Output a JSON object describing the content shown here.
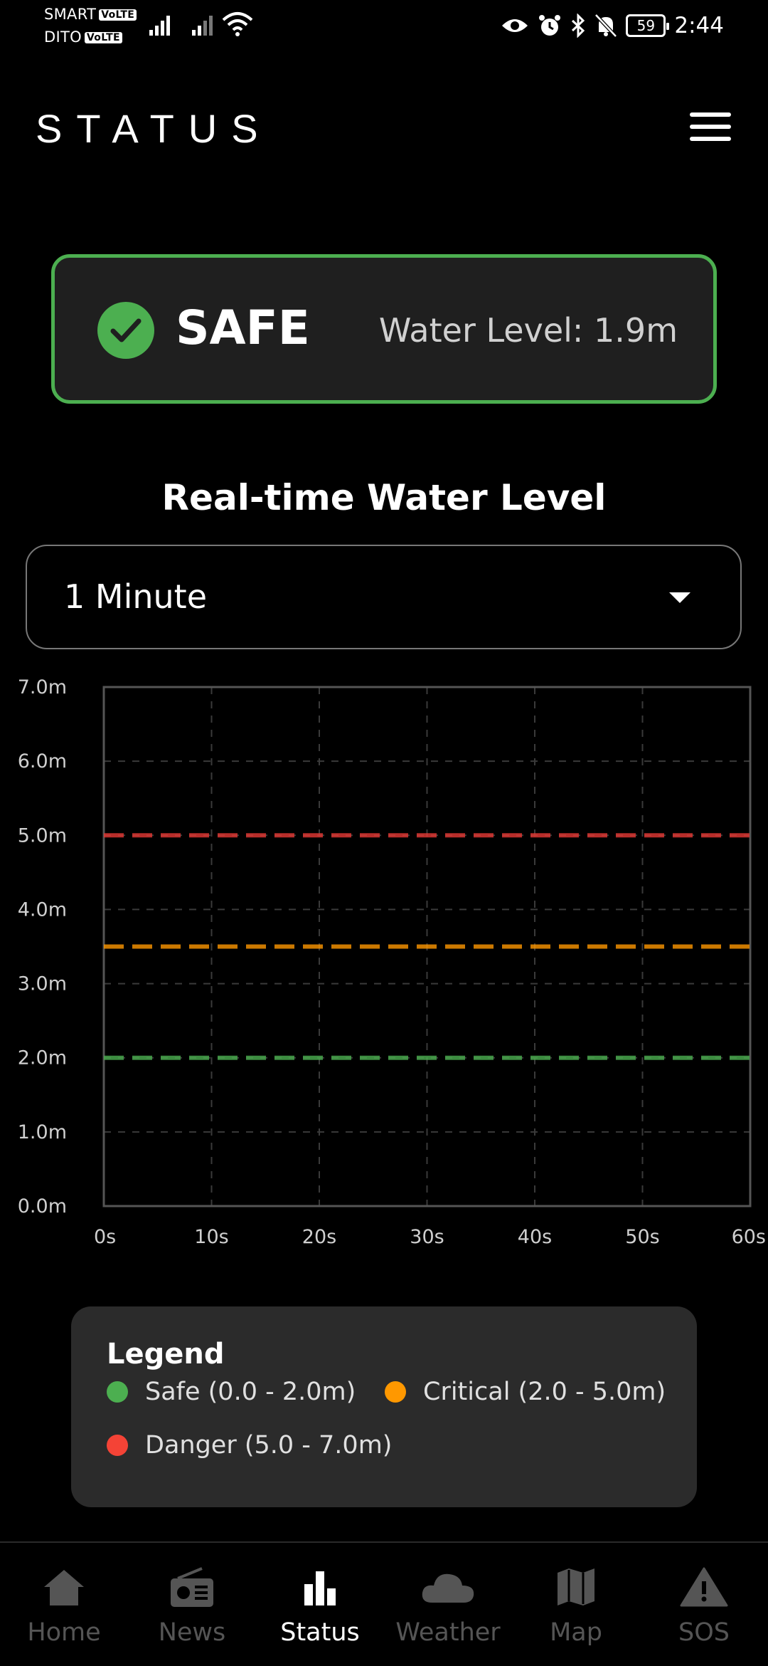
{
  "status_bar": {
    "carrier1": "SMART",
    "carrier2": "DITO",
    "volte": "VoLTE",
    "battery": "59",
    "time": "2:44"
  },
  "header": {
    "title": "STATUS"
  },
  "status_card": {
    "status": "SAFE",
    "water_level": "Water Level: 1.9m",
    "color": "#4caf50"
  },
  "section_title": "Real-time Water Level",
  "dropdown": {
    "selected": "1 Minute"
  },
  "chart_data": {
    "type": "line",
    "y_ticks": [
      "0.0m",
      "1.0m",
      "2.0m",
      "3.0m",
      "4.0m",
      "5.0m",
      "6.0m",
      "7.0m"
    ],
    "x_ticks": [
      "0s",
      "10s",
      "20s",
      "30s",
      "40s",
      "50s",
      "60s"
    ],
    "ylim": [
      0,
      7
    ],
    "xlim": [
      0,
      60
    ],
    "grid": true,
    "threshold_lines": [
      {
        "value": 5.0,
        "color": "#e53935"
      },
      {
        "value": 3.5,
        "color": "#ff9800"
      },
      {
        "value": 2.0,
        "color": "#4caf50"
      }
    ]
  },
  "legend": {
    "title": "Legend",
    "items": [
      {
        "label": "Safe (0.0 - 2.0m)",
        "color": "#4caf50"
      },
      {
        "label": "Critical (2.0 - 5.0m)",
        "color": "#ff9800"
      },
      {
        "label": "Danger (5.0 - 7.0m)",
        "color": "#f44336"
      }
    ]
  },
  "bottom_nav": {
    "active": "Status",
    "items": [
      {
        "label": "Home",
        "icon": "home-icon"
      },
      {
        "label": "News",
        "icon": "radio-icon"
      },
      {
        "label": "Status",
        "icon": "bar-chart-icon"
      },
      {
        "label": "Weather",
        "icon": "cloud-icon"
      },
      {
        "label": "Map",
        "icon": "map-icon"
      },
      {
        "label": "SOS",
        "icon": "warning-icon"
      }
    ]
  }
}
